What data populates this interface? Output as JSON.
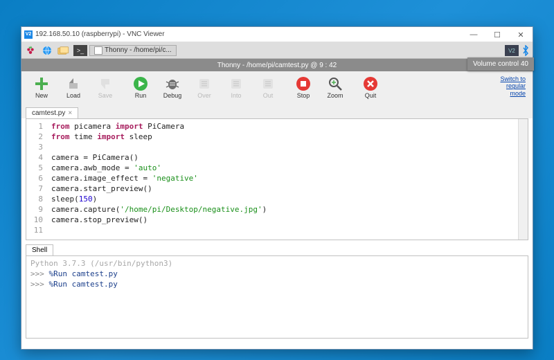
{
  "vnc": {
    "title": "192.168.50.10 (raspberrypi) - VNC Viewer"
  },
  "rpi_taskbar": {
    "thonny_task": "Thonny  -  /home/pi/c...",
    "volume_overlay": "Volume control 40"
  },
  "thonny": {
    "title": "Thonny  -  /home/pi/camtest.py  @  9 : 42",
    "switch_link": "Switch to\nregular\nmode"
  },
  "toolbar": {
    "new": "New",
    "load": "Load",
    "save": "Save",
    "run": "Run",
    "debug": "Debug",
    "over": "Over",
    "into": "Into",
    "out": "Out",
    "stop": "Stop",
    "zoom": "Zoom",
    "quit": "Quit"
  },
  "editor": {
    "tab": "camtest.py",
    "gutter": [
      "1",
      "2",
      "3",
      "4",
      "5",
      "6",
      "7",
      "8",
      "9",
      "10",
      "11"
    ],
    "lines": {
      "l1a": "from",
      "l1b": " picamera ",
      "l1c": "import",
      "l1d": " PiCamera",
      "l2a": "from",
      "l2b": " time ",
      "l2c": "import",
      "l2d": " sleep",
      "l4": "camera = PiCamera()",
      "l5a": "camera.awb_mode = ",
      "l5b": "'auto'",
      "l6a": "camera.image_effect = ",
      "l6b": "'negative'",
      "l7": "camera.start_preview()",
      "l8a": "sleep(",
      "l8b": "150",
      "l8c": ")",
      "l9a": "camera.capture(",
      "l9b": "'/home/pi/Desktop/negative.jpg'",
      "l9c": ")",
      "l10": "camera.stop_preview()"
    }
  },
  "shell": {
    "label": "Shell",
    "header": "Python 3.7.3 (/usr/bin/python3)",
    "prompt": ">>> ",
    "cmd1": "%Run camtest.py",
    "cmd2": "%Run camtest.py"
  }
}
